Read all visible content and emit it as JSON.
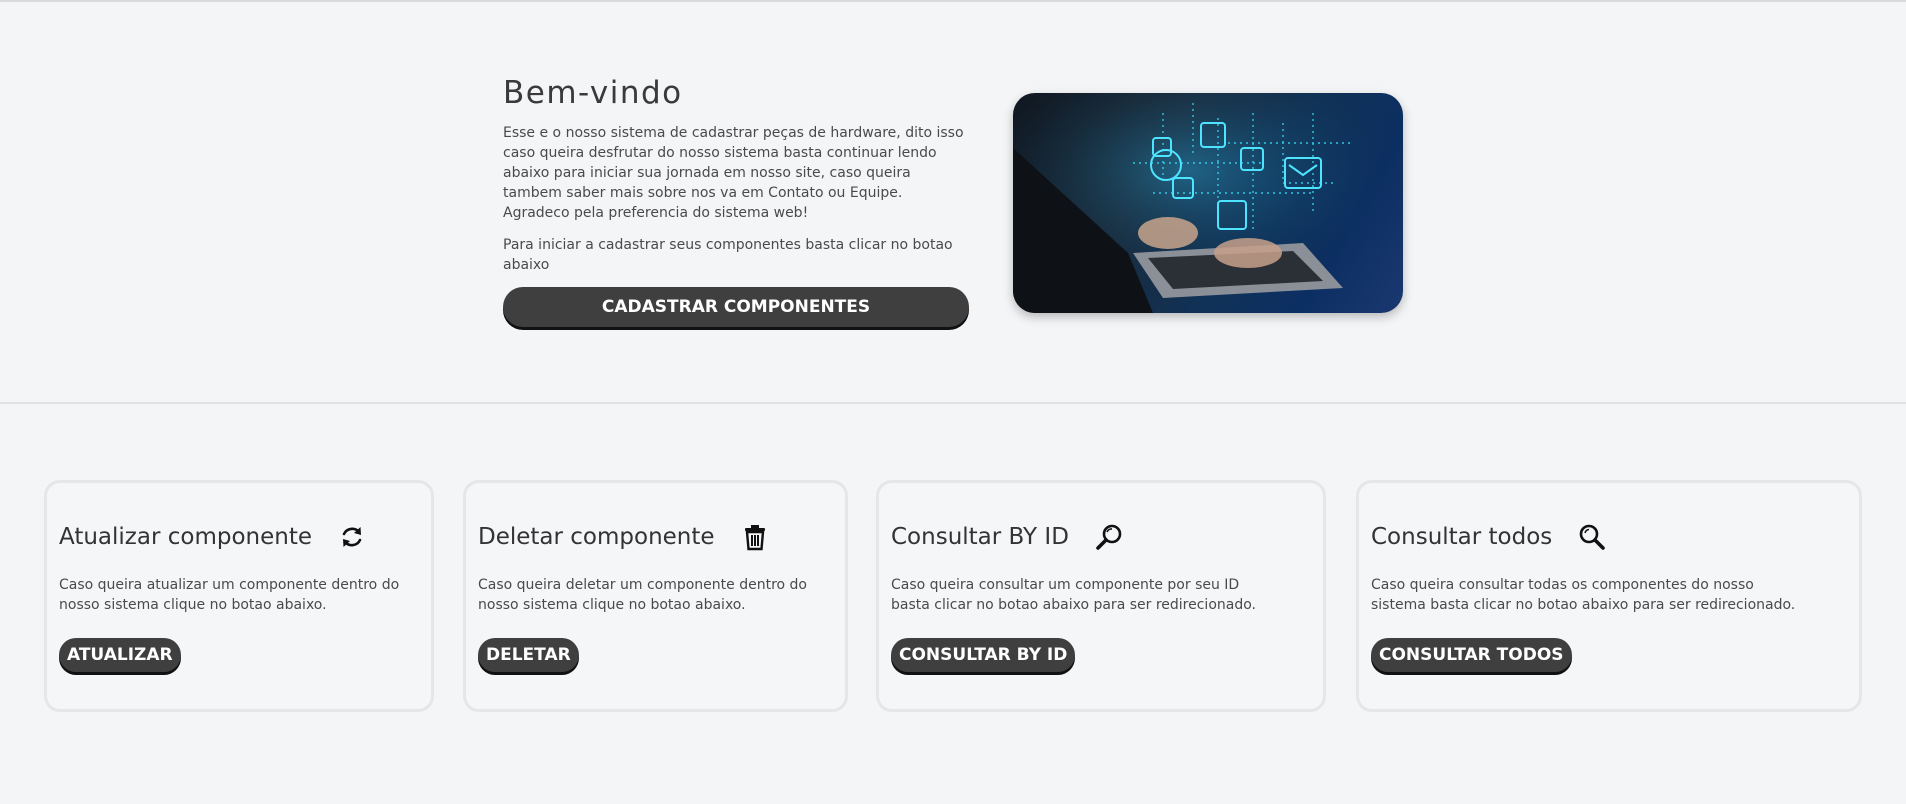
{
  "hero": {
    "title": "Bem-vindo",
    "paragraph1": "Esse e o nosso sistema de cadastrar peças de hardware, dito isso caso queira desfrutar do nosso sistema basta continuar lendo abaixo para iniciar sua jornada em nosso site, caso queira tambem saber mais sobre nos va em Contato ou Equipe. Agradeco pela preferencia do sistema web!",
    "paragraph2": "Para iniciar a cadastrar seus componentes basta clicar no botao abaixo",
    "button_label": "CADASTRAR COMPONENTES",
    "image_icon": "laptop-cybersecurity-image"
  },
  "cards": [
    {
      "title": "Atualizar componente",
      "icon": "refresh-icon",
      "description": "Caso queira atualizar um componente dentro do nosso sistema clique no botao abaixo.",
      "button_label": "ATUALIZAR"
    },
    {
      "title": "Deletar componente",
      "icon": "trash-icon",
      "description": "Caso queira deletar um componente dentro do nosso sistema clique no botao abaixo.",
      "button_label": "DELETAR"
    },
    {
      "title": "Consultar BY ID",
      "icon": "search-icon",
      "description": "Caso queira consultar um componente por seu ID basta clicar no botao abaixo para ser redirecionado.",
      "button_label": "CONSULTAR BY ID"
    },
    {
      "title": "Consultar todos",
      "icon": "search-icon",
      "description": "Caso queira consultar todas os componentes do nosso sistema basta clicar no botao abaixo para ser redirecionado.",
      "button_label": "CONSULTAR TODOS"
    }
  ],
  "colors": {
    "background": "#f4f5f7",
    "button": "#3f3f3f",
    "button_text": "#ffffff",
    "card_border": "#e6e6e8"
  }
}
